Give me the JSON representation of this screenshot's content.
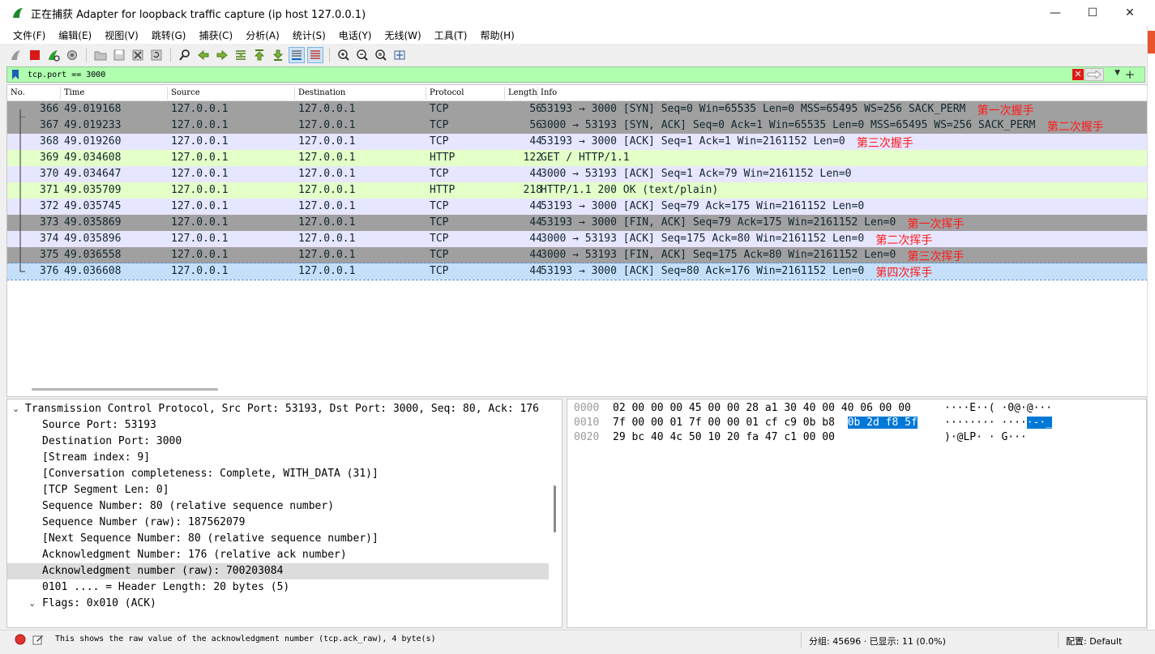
{
  "window": {
    "title": "正在捕获 Adapter for loopback traffic capture (ip host 127.0.0.1)",
    "minimize": "—",
    "maximize": "☐",
    "close": "✕"
  },
  "menu": [
    "文件(F)",
    "编辑(E)",
    "视图(V)",
    "跳转(G)",
    "捕获(C)",
    "分析(A)",
    "统计(S)",
    "电话(Y)",
    "无线(W)",
    "工具(T)",
    "帮助(H)"
  ],
  "filter": {
    "value": "tcp.port == 3000"
  },
  "columns": [
    "No.",
    "Time",
    "Source",
    "Destination",
    "Protocol",
    "Length",
    "Info"
  ],
  "colors": {
    "syn_fin": "#a0a0a0",
    "tcp": "#e7e6ff",
    "http": "#e4ffc7",
    "selected": "#c5dffb",
    "annotation": "#ff1a1a",
    "hex_selected": "#0078d7"
  },
  "packets": [
    {
      "no": "366",
      "time": "49.019168",
      "src": "127.0.0.1",
      "dst": "127.0.0.1",
      "proto": "TCP",
      "len": "56",
      "info": "53193 → 3000 [SYN] Seq=0 Win=65535 Len=0 MSS=65495 WS=256 SACK_PERM",
      "note": "第一次握手",
      "style": "syn_fin"
    },
    {
      "no": "367",
      "time": "49.019233",
      "src": "127.0.0.1",
      "dst": "127.0.0.1",
      "proto": "TCP",
      "len": "56",
      "info": "3000 → 53193 [SYN, ACK] Seq=0 Ack=1 Win=65535 Len=0 MSS=65495 WS=256 SACK_PERM",
      "note": "第二次握手",
      "style": "syn_fin"
    },
    {
      "no": "368",
      "time": "49.019260",
      "src": "127.0.0.1",
      "dst": "127.0.0.1",
      "proto": "TCP",
      "len": "44",
      "info": "53193 → 3000 [ACK] Seq=1 Ack=1 Win=2161152 Len=0",
      "note": "第三次握手",
      "style": "tcp"
    },
    {
      "no": "369",
      "time": "49.034608",
      "src": "127.0.0.1",
      "dst": "127.0.0.1",
      "proto": "HTTP",
      "len": "122",
      "info": "GET / HTTP/1.1",
      "note": "",
      "style": "http"
    },
    {
      "no": "370",
      "time": "49.034647",
      "src": "127.0.0.1",
      "dst": "127.0.0.1",
      "proto": "TCP",
      "len": "44",
      "info": "3000 → 53193 [ACK] Seq=1 Ack=79 Win=2161152 Len=0",
      "note": "",
      "style": "tcp"
    },
    {
      "no": "371",
      "time": "49.035709",
      "src": "127.0.0.1",
      "dst": "127.0.0.1",
      "proto": "HTTP",
      "len": "218",
      "info": "HTTP/1.1 200 OK  (text/plain)",
      "note": "",
      "style": "http"
    },
    {
      "no": "372",
      "time": "49.035745",
      "src": "127.0.0.1",
      "dst": "127.0.0.1",
      "proto": "TCP",
      "len": "44",
      "info": "53193 → 3000 [ACK] Seq=79 Ack=175 Win=2161152 Len=0",
      "note": "",
      "style": "tcp"
    },
    {
      "no": "373",
      "time": "49.035869",
      "src": "127.0.0.1",
      "dst": "127.0.0.1",
      "proto": "TCP",
      "len": "44",
      "info": "53193 → 3000 [FIN, ACK] Seq=79 Ack=175 Win=2161152 Len=0",
      "note": "第一次挥手",
      "style": "syn_fin"
    },
    {
      "no": "374",
      "time": "49.035896",
      "src": "127.0.0.1",
      "dst": "127.0.0.1",
      "proto": "TCP",
      "len": "44",
      "info": "3000 → 53193 [ACK] Seq=175 Ack=80 Win=2161152 Len=0",
      "note": "第二次挥手",
      "style": "tcp"
    },
    {
      "no": "375",
      "time": "49.036558",
      "src": "127.0.0.1",
      "dst": "127.0.0.1",
      "proto": "TCP",
      "len": "44",
      "info": "3000 → 53193 [FIN, ACK] Seq=175 Ack=80 Win=2161152 Len=0",
      "note": "第三次挥手",
      "style": "syn_fin"
    },
    {
      "no": "376",
      "time": "49.036608",
      "src": "127.0.0.1",
      "dst": "127.0.0.1",
      "proto": "TCP",
      "len": "44",
      "info": "53193 → 3000 [ACK] Seq=80 Ack=176 Win=2161152 Len=0",
      "note": "第四次挥手",
      "style": "selected"
    }
  ],
  "detail": [
    {
      "text": "Transmission Control Protocol, Src Port: 53193, Dst Port: 3000, Seq: 80, Ack: 176",
      "indent": 0,
      "expanded": true
    },
    {
      "text": "Source Port: 53193",
      "indent": 1
    },
    {
      "text": "Destination Port: 3000",
      "indent": 1
    },
    {
      "text": "[Stream index: 9]",
      "indent": 1
    },
    {
      "text": "[Conversation completeness: Complete, WITH_DATA (31)]",
      "indent": 1
    },
    {
      "text": "[TCP Segment Len: 0]",
      "indent": 1
    },
    {
      "text": "Sequence Number: 80    (relative sequence number)",
      "indent": 1
    },
    {
      "text": "Sequence Number (raw): 187562079",
      "indent": 1
    },
    {
      "text": "[Next Sequence Number: 80    (relative sequence number)]",
      "indent": 1
    },
    {
      "text": "Acknowledgment Number: 176    (relative ack number)",
      "indent": 1
    },
    {
      "text": "Acknowledgment number (raw): 700203084",
      "indent": 1,
      "highlight": true
    },
    {
      "text": "0101 .... = Header Length: 20 bytes (5)",
      "indent": 1
    },
    {
      "text": "Flags: 0x010 (ACK)",
      "indent": 1,
      "expanded": true
    }
  ],
  "hex": [
    {
      "offset": "0000",
      "pre": "02 00 00 00 45 00 00 28  a1 30 40 00 40 06 00 00",
      "sel": "",
      "ascii_pre": "····E··( ·0@·@···",
      "ascii_sel": ""
    },
    {
      "offset": "0010",
      "pre": "7f 00 00 01 7f 00 00 01  cf c9 0b b8 ",
      "sel": "0b 2d f8 5f",
      "ascii_pre": "········ ····",
      "ascii_sel": "·-·_"
    },
    {
      "offset": "0020",
      "pre": "29 bc 40 4c 50 10 20 fa  47 c1 00 00",
      "sel": "",
      "ascii_pre": ")·@LP· · G···",
      "ascii_sel": ""
    }
  ],
  "status": {
    "message": "This shows the raw value of the acknowledgment number (tcp.ack_raw), 4 byte(s)",
    "packets": "分组: 45696 · 已显示: 11 (0.0%)",
    "profile": "配置: Default"
  }
}
